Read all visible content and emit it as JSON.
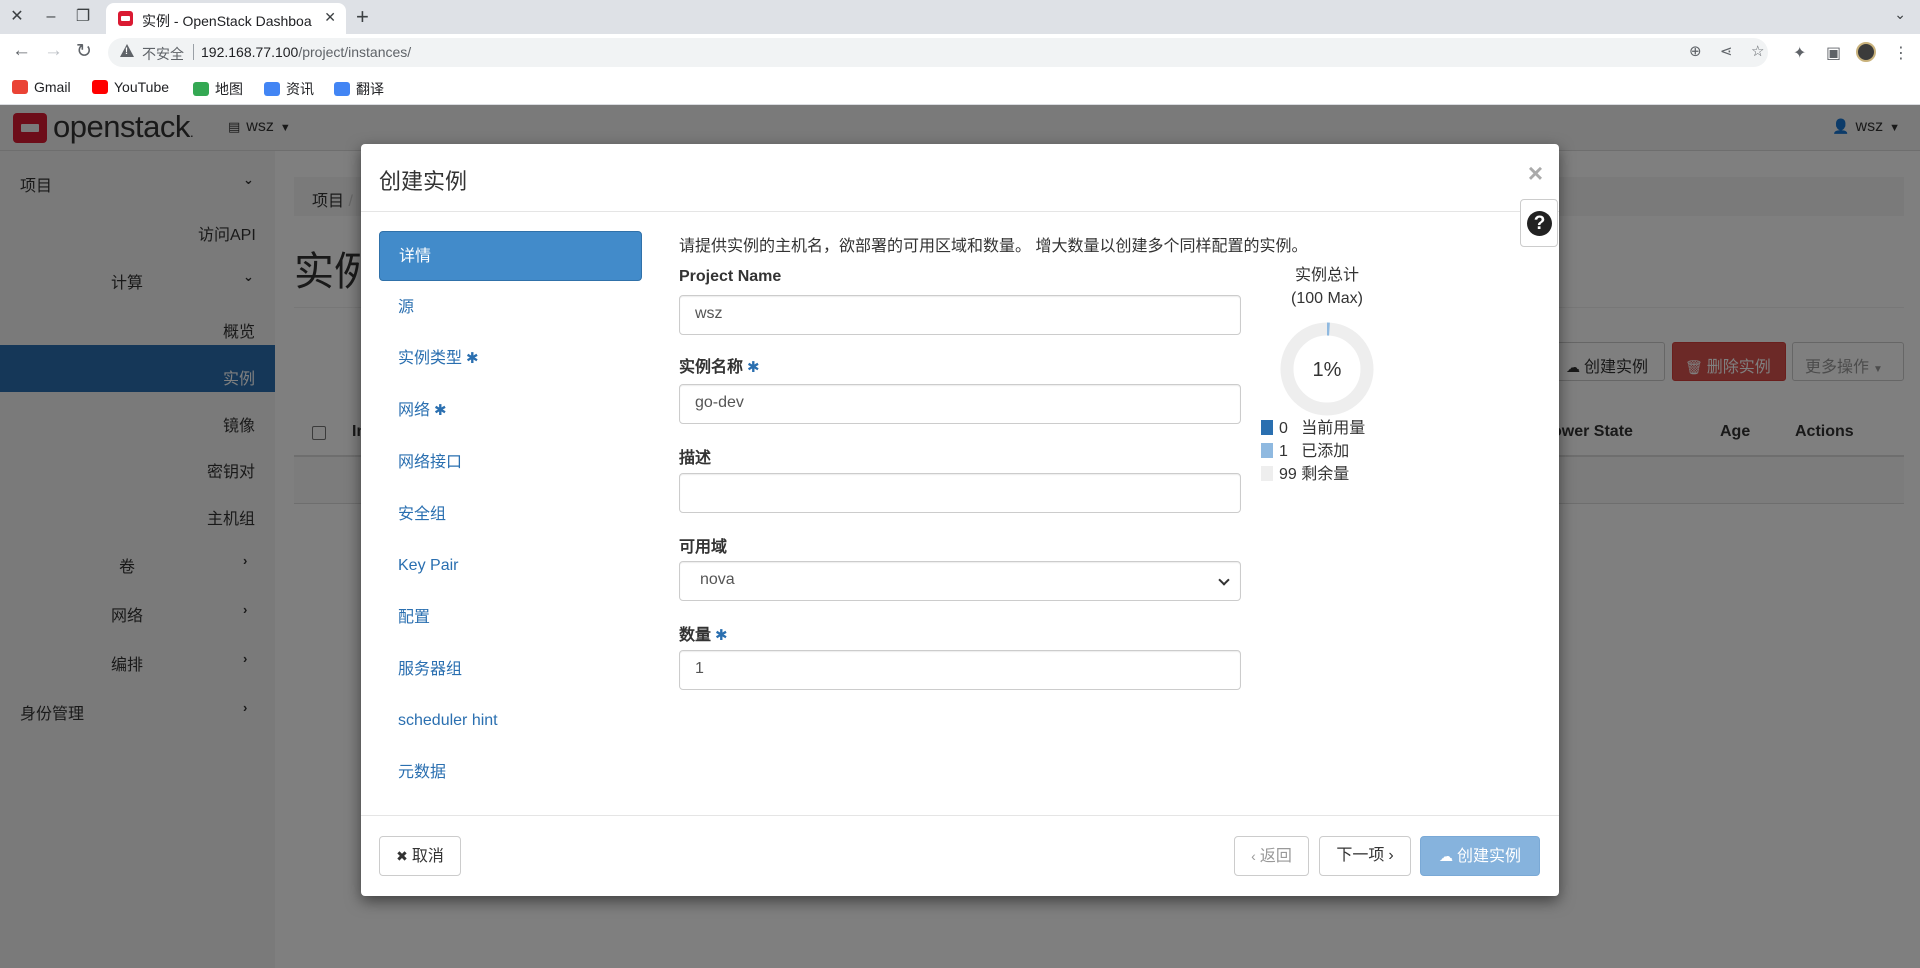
{
  "browser": {
    "tab_title": "实例 - OpenStack Dashboard",
    "new_tab_icon": "+",
    "security_label": "不安全",
    "url_host": "192.168.77.100",
    "url_path": "/project/instances/",
    "bookmarks": [
      {
        "label": "Gmail",
        "icon": "gmail-icon",
        "color": "#ea4335"
      },
      {
        "label": "YouTube",
        "icon": "youtube-icon",
        "color": "#ff0000"
      },
      {
        "label": "地图",
        "icon": "maps-icon",
        "color": "#34a853"
      },
      {
        "label": "资讯",
        "icon": "news-icon",
        "color": "#4285f4"
      },
      {
        "label": "翻译",
        "icon": "translate-icon",
        "color": "#4285f4"
      }
    ]
  },
  "app": {
    "brand": "openstack",
    "brand_suffix": ".",
    "brand_color": "#da1a32",
    "project_selector": "wsz",
    "user_menu": "wsz"
  },
  "sidebar": {
    "items": [
      {
        "label": "项目",
        "chevron": "down"
      },
      {
        "label": "访问API"
      },
      {
        "label": "计算",
        "chevron": "down"
      },
      {
        "label": "概览"
      },
      {
        "label": "实例",
        "active": true
      },
      {
        "label": "镜像"
      },
      {
        "label": "密钥对"
      },
      {
        "label": "主机组"
      },
      {
        "label": "卷",
        "chevron": "right"
      },
      {
        "label": "网络",
        "chevron": "right"
      },
      {
        "label": "编排",
        "chevron": "right"
      },
      {
        "label": "身份管理",
        "chevron": "right"
      }
    ],
    "active_color": "#2a6fb0"
  },
  "background_page": {
    "breadcrumb_first": "项目",
    "breadcrumb_sep": "/",
    "title": "实例",
    "buttons": {
      "launch": "创建实例",
      "delete": "删除实例",
      "more": "更多操作"
    },
    "table_headers": {
      "first": "In",
      "power_state": "ower State",
      "age": "Age",
      "actions": "Actions"
    }
  },
  "modal": {
    "title": "创建实例",
    "close_icon": "×",
    "help_icon": "?",
    "steps": [
      {
        "label": "详情",
        "active": true
      },
      {
        "label": "源"
      },
      {
        "label": "实例类型",
        "required": true
      },
      {
        "label": "网络",
        "required": true
      },
      {
        "label": "网络接口"
      },
      {
        "label": "安全组"
      },
      {
        "label": "Key Pair"
      },
      {
        "label": "配置"
      },
      {
        "label": "服务器组"
      },
      {
        "label": "scheduler hint"
      },
      {
        "label": "元数据"
      }
    ],
    "required_mark": "✱",
    "help_text": "请提供实例的主机名，欲部署的可用区域和数量。 增大数量以创建多个同样配置的实例。",
    "fields": {
      "project_name": {
        "label": "Project Name",
        "value": "wsz"
      },
      "instance_name": {
        "label": "实例名称",
        "value": "go-dev"
      },
      "description": {
        "label": "描述",
        "value": ""
      },
      "availability_zone": {
        "label": "可用域",
        "value": "nova"
      },
      "count": {
        "label": "数量",
        "value": "1"
      }
    },
    "quota": {
      "title_line1": "实例总计",
      "title_line2": "(100 Max)",
      "percent_label": "1%",
      "used_fraction": 0.01,
      "legend": [
        {
          "value": "0",
          "label": "当前用量",
          "color": "#2a6fb0"
        },
        {
          "value": "1",
          "label": "已添加",
          "color": "#8fb9e0"
        },
        {
          "value": "99",
          "label": "剩余量",
          "color": "#eeeeee"
        }
      ]
    },
    "footer": {
      "cancel": "取消",
      "back": "返回",
      "next": "下一项",
      "launch": "创建实例"
    }
  }
}
